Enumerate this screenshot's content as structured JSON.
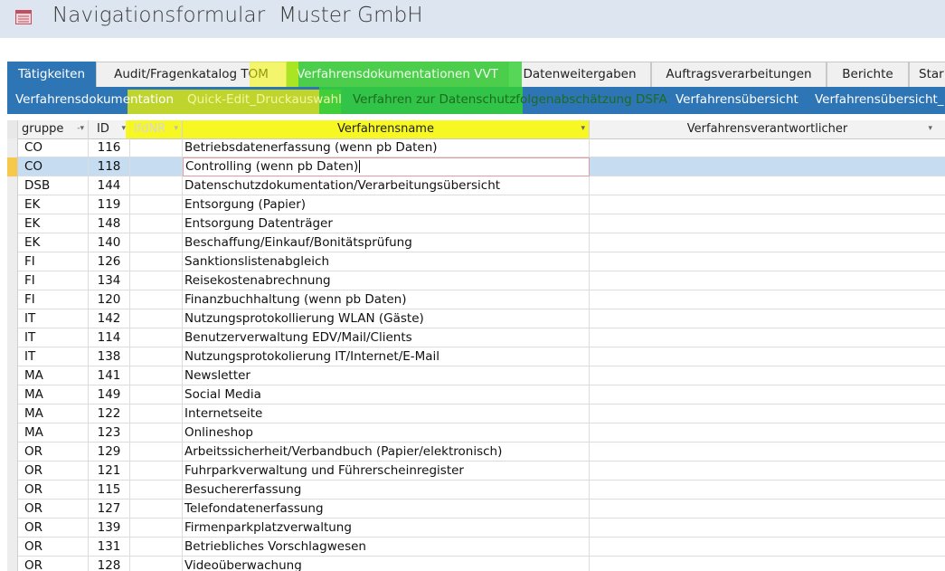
{
  "window": {
    "title": "Navigationsformular  Muster GmbH",
    "icon": "form-icon"
  },
  "tabs": [
    {
      "label": "Tätigkeiten",
      "active": true
    },
    {
      "label": "Audit/Fragenkatalog TOM",
      "active": false
    },
    {
      "label": "Verfahrensdokumentationen VVT",
      "active": false
    },
    {
      "label": "Datenweitergaben",
      "active": false
    },
    {
      "label": "Auftragsverarbeitungen",
      "active": false
    },
    {
      "label": "Berichte",
      "active": false
    },
    {
      "label": "Star",
      "active": false
    }
  ],
  "subtabs": [
    {
      "label": "Verfahrensdokumentation"
    },
    {
      "label": "Quick-Edit_Druckauswahl"
    },
    {
      "label": "Verfahren zur Datenschutzfolgenabschätzung DSFA"
    },
    {
      "label": "Verfahrensübersicht"
    },
    {
      "label": "Verfahrensübersicht_"
    }
  ],
  "columns": {
    "gruppe": "gruppe",
    "id": "ID",
    "lfdnr": "lfdNR",
    "name": "Verfahrensname",
    "verantwortlich": "Verfahrensverantwortlicher"
  },
  "rows": [
    {
      "gruppe": "CO",
      "id": "116",
      "name": "Betriebsdatenerfassung (wenn pb Daten)"
    },
    {
      "gruppe": "CO",
      "id": "118",
      "name": "Controlling (wenn pb Daten)"
    },
    {
      "gruppe": "DSB",
      "id": "144",
      "name": "Datenschutzdokumentation/Verarbeitungsübersicht"
    },
    {
      "gruppe": "EK",
      "id": "119",
      "name": "Entsorgung (Papier)"
    },
    {
      "gruppe": "EK",
      "id": "148",
      "name": "Entsorgung Datenträger"
    },
    {
      "gruppe": "EK",
      "id": "140",
      "name": "Beschaffung/Einkauf/Bonitätsprüfung"
    },
    {
      "gruppe": "FI",
      "id": "126",
      "name": "Sanktionslistenabgleich"
    },
    {
      "gruppe": "FI",
      "id": "134",
      "name": "Reisekostenabrechnung"
    },
    {
      "gruppe": "FI",
      "id": "120",
      "name": "Finanzbuchhaltung (wenn pb Daten)"
    },
    {
      "gruppe": "IT",
      "id": "142",
      "name": "Nutzungsprotokollierung WLAN (Gäste)"
    },
    {
      "gruppe": "IT",
      "id": "114",
      "name": "Benutzerverwaltung EDV/Mail/Clients"
    },
    {
      "gruppe": "IT",
      "id": "138",
      "name": "Nutzungsprotokolierung IT/Internet/E-Mail"
    },
    {
      "gruppe": "MA",
      "id": "141",
      "name": "Newsletter"
    },
    {
      "gruppe": "MA",
      "id": "149",
      "name": "Social Media"
    },
    {
      "gruppe": "MA",
      "id": "122",
      "name": "Internetseite"
    },
    {
      "gruppe": "MA",
      "id": "123",
      "name": "Onlineshop"
    },
    {
      "gruppe": "OR",
      "id": "129",
      "name": "Arbeitssicherheit/Verbandbuch (Papier/elektronisch)"
    },
    {
      "gruppe": "OR",
      "id": "121",
      "name": "Fuhrparkverwaltung und Führerscheinregister"
    },
    {
      "gruppe": "OR",
      "id": "115",
      "name": "Besuchererfassung"
    },
    {
      "gruppe": "OR",
      "id": "127",
      "name": "Telefondatenerfassung"
    },
    {
      "gruppe": "OR",
      "id": "139",
      "name": "Firmenparkplatzverwaltung"
    },
    {
      "gruppe": "OR",
      "id": "131",
      "name": "Betriebliches Vorschlagwesen"
    },
    {
      "gruppe": "OR",
      "id": "128",
      "name": "Videoüberwachung"
    }
  ],
  "selected_row": 1,
  "colors": {
    "accent": "#2e75b6",
    "highlight_yellow": "#f5fa00",
    "highlight_green": "#3cd23c",
    "selected_row": "#c6dcf1",
    "record_selector": "#f6c84c"
  }
}
